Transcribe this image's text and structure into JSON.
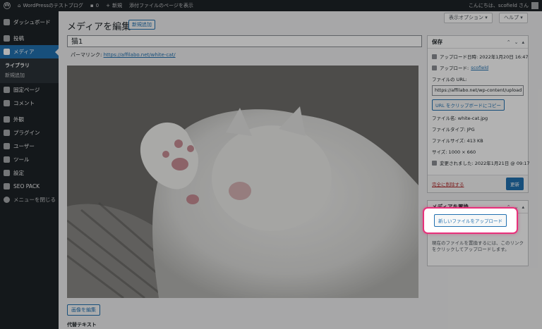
{
  "adminbar": {
    "site_name": "WordPressのテストブログ",
    "comments_count": "0",
    "new_label": "新規",
    "view_attachment_label": "添付ファイルのページを表示",
    "greeting": "こんにちは、scofield さん"
  },
  "sidebar": {
    "items": [
      {
        "label": "ダッシュボード"
      },
      {
        "label": "投稿"
      },
      {
        "label": "メディア"
      },
      {
        "label": "固定ページ"
      },
      {
        "label": "コメント"
      },
      {
        "label": "外観"
      },
      {
        "label": "プラグイン"
      },
      {
        "label": "ユーザー"
      },
      {
        "label": "ツール"
      },
      {
        "label": "設定"
      },
      {
        "label": "SEO PACK"
      },
      {
        "label": "メニューを閉じる"
      }
    ],
    "submenu": [
      "ライブラリ",
      "新規追加"
    ]
  },
  "header": {
    "screen_options": "表示オプション ▾",
    "help": "ヘルプ ▾",
    "title": "メディアを編集",
    "add_new": "新規追加"
  },
  "post": {
    "title_value": "猫1",
    "permalink_label": "パーマリンク:",
    "permalink_url": "https://affilabo.net/white-cat/",
    "edit_image": "画像を編集",
    "alt_text_label": "代替テキスト"
  },
  "save_box": {
    "title": "保存",
    "uploaded_on": "アップロード日時: 2022年1月20日 16:47",
    "uploaded_by_label": "アップロード:",
    "uploaded_by_user": "scofield",
    "file_url_label": "ファイルの URL:",
    "file_url_value": "https://affilabo.net/wp-content/upload",
    "copy_url_button": "URL をクリップボードにコピー",
    "file_name": "ファイル名: white-cat.jpg",
    "file_type": "ファイルタイプ: JPG",
    "file_size": "ファイルサイズ: 413 KB",
    "dimensions": "サイズ: 1000 × 660",
    "modified": "変更されました: 2022年1月21日 @ 09:17",
    "delete_link": "完全に削除する",
    "update_button": "更新"
  },
  "replace_box": {
    "title": "メディアを置換",
    "upload_button": "新しいファイルをアップロード",
    "description": "現在のファイルを置換するには、このリンクをクリックしてアップロードします。"
  },
  "colors": {
    "highlight": "#e8307a",
    "accent": "#2271b1",
    "adminbar": "#1d2327"
  }
}
